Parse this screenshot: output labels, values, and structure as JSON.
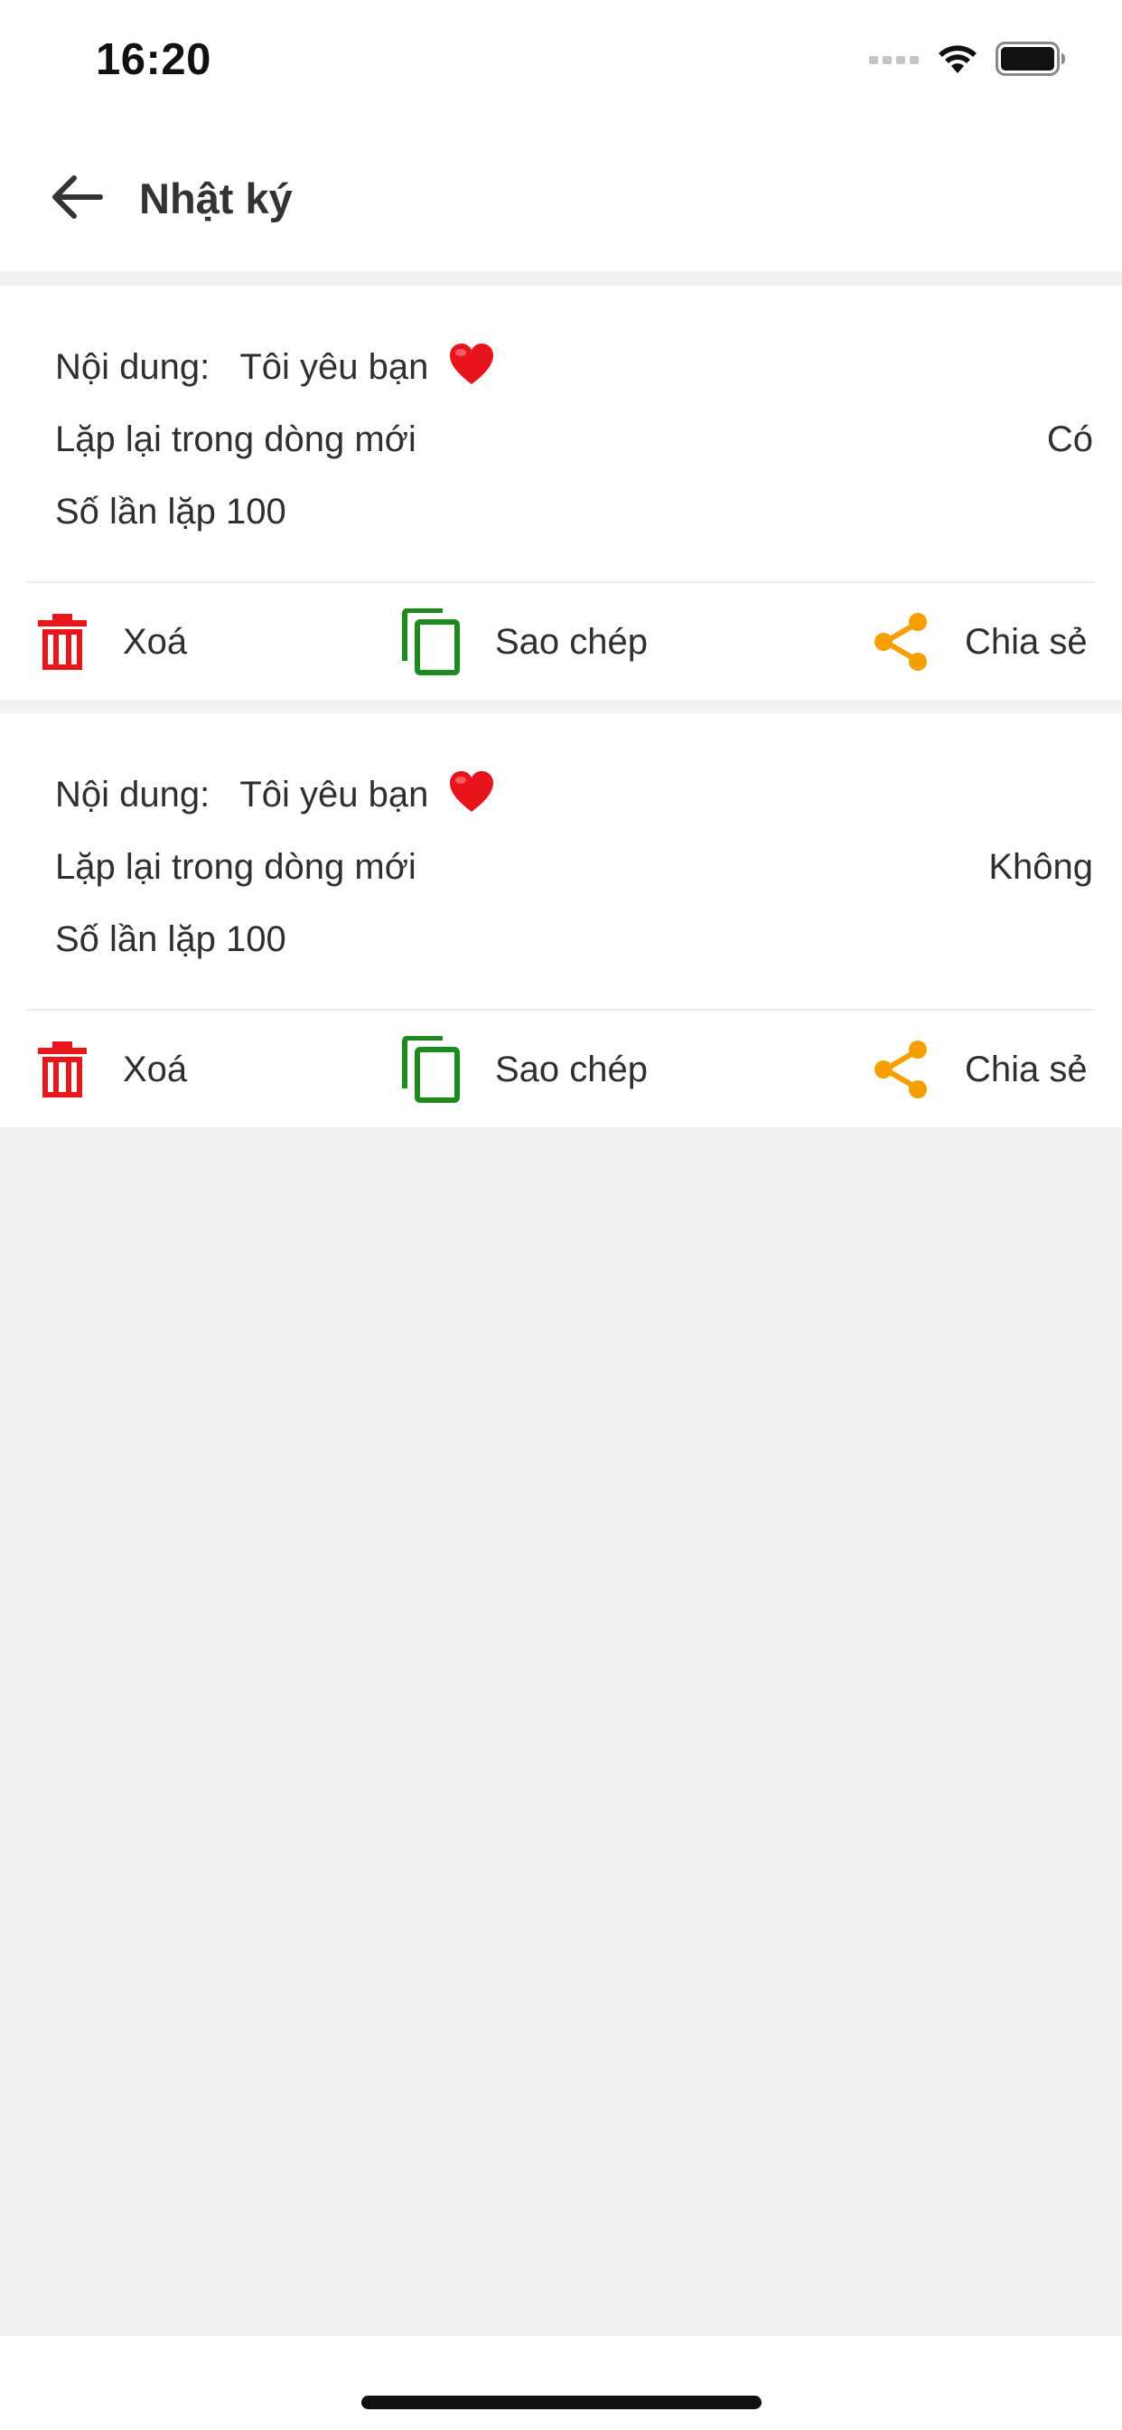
{
  "status_bar": {
    "time": "16:20"
  },
  "app_bar": {
    "title": "Nhật ký",
    "back_icon": "arrow-left-icon"
  },
  "colors": {
    "delete": "#e8161b",
    "copy": "#1c8a1c",
    "share": "#f5a000",
    "background": "#f1f1f1"
  },
  "entries": [
    {
      "content_label": "Nội dung:",
      "content_value": "Tôi yêu bạn",
      "repeat_newline_label": "Lặp lại trong dòng mới",
      "repeat_newline_value": "Có",
      "repeat_count_label": "Số lần lặp 100",
      "actions": {
        "delete": "Xoá",
        "copy": "Sao chép",
        "share": "Chia sẻ"
      }
    },
    {
      "content_label": "Nội dung:",
      "content_value": "Tôi yêu bạn",
      "repeat_newline_label": "Lặp lại trong dòng mới",
      "repeat_newline_value": "Không",
      "repeat_count_label": "Số lần lặp 100",
      "actions": {
        "delete": "Xoá",
        "copy": "Sao chép",
        "share": "Chia sẻ"
      }
    }
  ]
}
